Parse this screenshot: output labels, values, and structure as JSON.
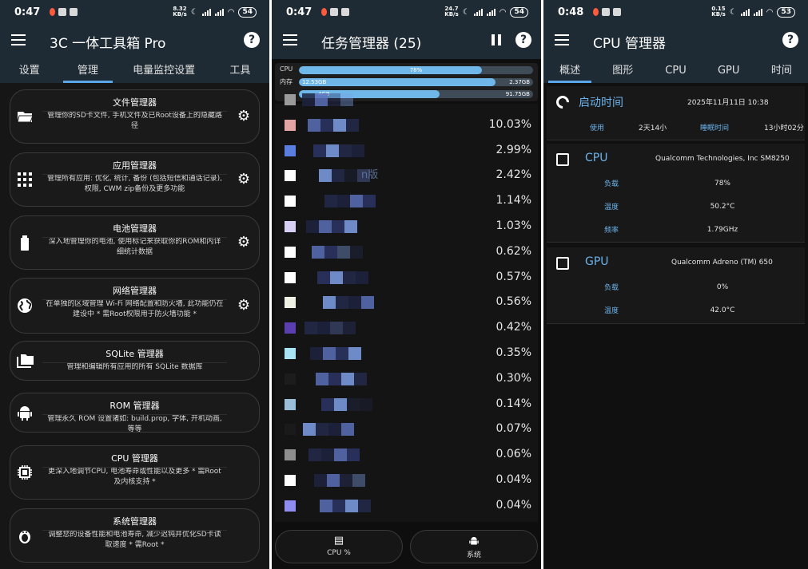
{
  "panel1": {
    "status": {
      "time": "0:47",
      "speed": "8.32\nKB/s",
      "battery": "54"
    },
    "title": "3C 一体工具箱 Pro",
    "tabs": [
      "设置",
      "管理",
      "电量监控设置",
      "工具"
    ],
    "active_tab": "管理",
    "cards": [
      {
        "title": "文件管理器",
        "desc": "管理你的SD卡文件, 手机文件及已Root设备上的隐藏路径",
        "icon": "folder-open-icon",
        "gear": true
      },
      {
        "title": "应用管理器",
        "desc": "管理所有应用: 优化, 统计, 备份 (包括短信和通话记录), 权限, CWM zip备份及更多功能",
        "icon": "apps-grid-icon",
        "gear": true
      },
      {
        "title": "电池管理器",
        "desc": "深入地管理你的电池, 使用标记来获取你的ROM和内详细统计数据",
        "icon": "battery-icon",
        "gear": true
      },
      {
        "title": "网络管理器",
        "desc": "在单独的区域管理 Wi-Fi 网络配置和防火墙, 此功能仍在建设中 * 需Root权限用于防火墙功能 *",
        "icon": "globe-icon",
        "gear": true
      },
      {
        "title": "SQLite 管理器",
        "desc": "管理和编辑所有应用的所有 SQLite 数据库",
        "icon": "folders-icon",
        "gear": false
      },
      {
        "title": "ROM 管理器",
        "desc": "管理永久 ROM 设置诸如: build.prop, 字体, 开机动画, 等等",
        "icon": "android-icon",
        "gear": false
      },
      {
        "title": "CPU 管理器",
        "desc": "更深入地调节CPU, 电池寿命或性能以及更多 * 需Root及内核支持 *",
        "icon": "chip-icon",
        "gear": false
      },
      {
        "title": "系统管理器",
        "desc": "调整您的设备性能和电池寿命, 减少迟钝并优化SD卡读取速度 * 需Root *",
        "icon": "linux-penguin-icon",
        "gear": false
      }
    ]
  },
  "panel2": {
    "status": {
      "time": "0:47",
      "speed": "24.7\nKB/s",
      "battery": "54"
    },
    "title": "任务管理器 (25)",
    "meters": {
      "cpu_label": "CPU",
      "cpu_text": "78%",
      "cpu_fraction": 0.78,
      "mem_label": "内存",
      "mem_left": "12.53GB",
      "mem_right": "2.37GB",
      "mem_fraction": 0.84,
      "store_left": "4GB",
      "store_right": "91.75GB",
      "store_fraction": 0.6
    },
    "ghost_text": "n版",
    "processes": [
      {
        "pct": "",
        "color": "#9a9a9a"
      },
      {
        "pct": "10.03%",
        "color": "#e4a4a4"
      },
      {
        "pct": "2.99%",
        "color": "#5a7ee0"
      },
      {
        "pct": "2.42%",
        "color": "#ffffff"
      },
      {
        "pct": "1.14%",
        "color": "#ffffff"
      },
      {
        "pct": "1.03%",
        "color": "#d8d0f4"
      },
      {
        "pct": "0.62%",
        "color": "#ffffff"
      },
      {
        "pct": "0.57%",
        "color": "#ffffff"
      },
      {
        "pct": "0.56%",
        "color": "#eef0e4"
      },
      {
        "pct": "0.42%",
        "color": "#5b3fb0"
      },
      {
        "pct": "0.35%",
        "color": "#a8e4f4"
      },
      {
        "pct": "0.30%",
        "color": "#1c1c1c"
      },
      {
        "pct": "0.14%",
        "color": "#9bbfd9"
      },
      {
        "pct": "0.07%",
        "color": "#1a1a1a"
      },
      {
        "pct": "0.06%",
        "color": "#8e8e8e"
      },
      {
        "pct": "0.04%",
        "color": "#ffffff"
      },
      {
        "pct": "0.04%",
        "color": "#8f8ef0"
      }
    ],
    "bottom": [
      {
        "label": "CPU %",
        "icon": "sort-icon"
      },
      {
        "label": "系统",
        "icon": "android-icon"
      }
    ]
  },
  "panel3": {
    "status": {
      "time": "0:48",
      "speed": "0.15\nKB/s",
      "battery": "53"
    },
    "title": "CPU 管理器",
    "tabs": [
      "概述",
      "图形",
      "CPU",
      "GPU",
      "时间"
    ],
    "active_tab": "概述",
    "boot": {
      "title": "启动时间",
      "datetime": "2025年11月11日 10:38",
      "k1": "使用",
      "v1": "2天14小",
      "k2": "睡眠时间",
      "v2": "13小时02分"
    },
    "cpu": {
      "title": "CPU",
      "name": "Qualcomm Technologies, Inc SM8250",
      "rows": [
        [
          "负载",
          "78%"
        ],
        [
          "温度",
          "50.2°C"
        ],
        [
          "频率",
          "1.79GHz"
        ]
      ]
    },
    "gpu": {
      "title": "GPU",
      "name": "Qualcomm Adreno (TM) 650",
      "rows": [
        [
          "负载",
          "0%"
        ],
        [
          "温度",
          "42.0°C"
        ]
      ]
    }
  }
}
